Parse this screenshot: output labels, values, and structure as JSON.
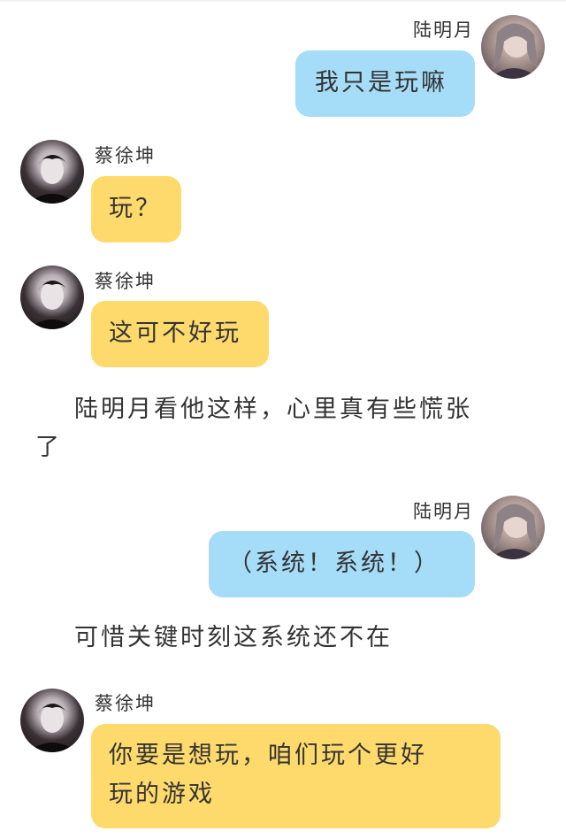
{
  "chat": {
    "messages": [
      {
        "speaker": "陆明月",
        "text": "我只是玩嘛"
      },
      {
        "speaker": "蔡徐坤",
        "text": "玩？"
      },
      {
        "speaker": "蔡徐坤",
        "text": "这可不好玩"
      },
      {
        "speaker": "陆明月",
        "text": "（系统！系统！）"
      },
      {
        "speaker": "蔡徐坤",
        "text_line1": "你要是想玩，咱们玩个更好",
        "text_line2": "玩的游戏"
      }
    ],
    "narration": [
      {
        "line1": "陆明月看他这样，心里真有些慌张",
        "line2": "了"
      },
      {
        "line1": "可惜关键时刻这系统还不在"
      }
    ]
  },
  "avatars": {
    "female": "female-avatar-photo",
    "male": "male-avatar-photo"
  },
  "colors": {
    "blue_bubble": "#a5dcf7",
    "yellow_bubble": "#fed96b"
  }
}
